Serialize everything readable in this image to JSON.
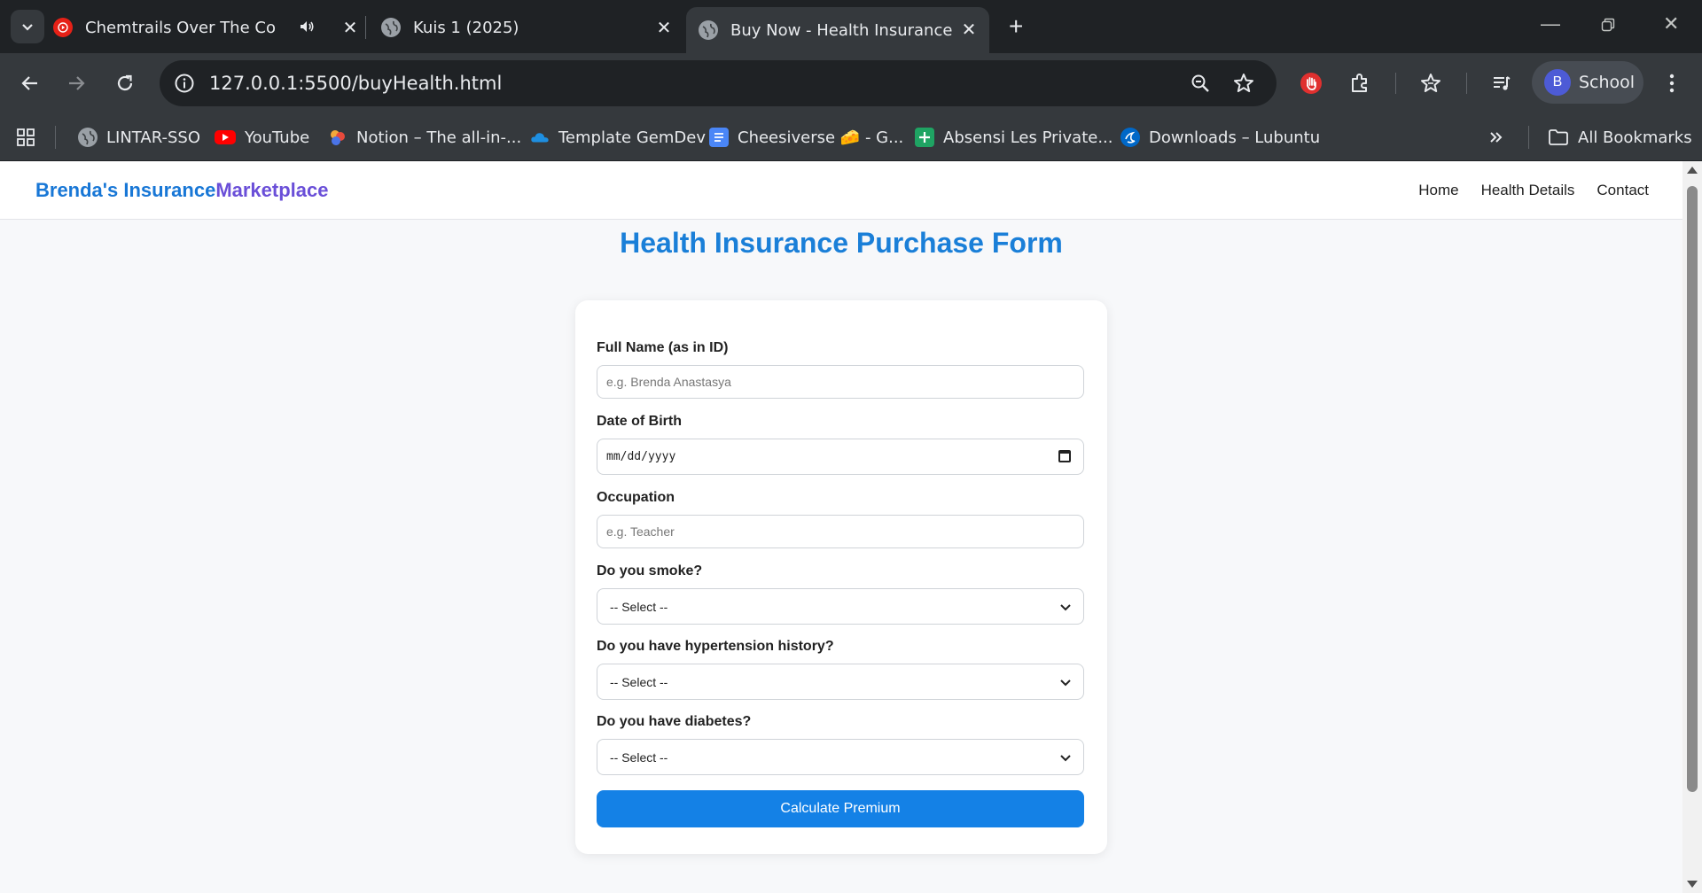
{
  "browser": {
    "tabs": [
      {
        "title": "Chemtrails Over The Countr",
        "favicon": "youtube-music-icon",
        "audio": true
      },
      {
        "title": "Kuis 1 (2025)",
        "favicon": "globe-icon"
      },
      {
        "title": "Buy Now - Health Insurance",
        "favicon": "globe-icon",
        "active": true
      }
    ],
    "url": "127.0.0.1:5500/buyHealth.html",
    "profile": {
      "initial": "B",
      "label": "School"
    },
    "bookmarks": [
      {
        "label": "LINTAR-SSO",
        "icon": "globe-icon"
      },
      {
        "label": "YouTube",
        "icon": "youtube-icon"
      },
      {
        "label": "Notion – The all-in-...",
        "icon": "notion-icon"
      },
      {
        "label": "Template GemDev",
        "icon": "onedrive-icon"
      },
      {
        "label": "Cheesiverse 🧀 - G...",
        "icon": "google-docs-icon"
      },
      {
        "label": "Absensi Les Private...",
        "icon": "google-sheets-icon"
      },
      {
        "label": "Downloads – Lubuntu",
        "icon": "lubuntu-icon"
      }
    ],
    "all_bookmarks_label": "All Bookmarks"
  },
  "site": {
    "brand_main": "Brenda's Insurance",
    "brand_accent": "Marketplace",
    "nav": [
      "Home",
      "Health Details",
      "Contact"
    ],
    "page_title": "Health Insurance Purchase Form"
  },
  "form": {
    "full_name": {
      "label": "Full Name (as in ID)",
      "placeholder": "e.g. Brenda Anastasya"
    },
    "dob": {
      "label": "Date of Birth",
      "placeholder": "mm/dd/yyyy"
    },
    "occupation": {
      "label": "Occupation",
      "placeholder": "e.g. Teacher"
    },
    "smoke": {
      "label": "Do you smoke?",
      "value": "-- Select --"
    },
    "hypertension": {
      "label": "Do you have hypertension history?",
      "value": "-- Select --"
    },
    "diabetes": {
      "label": "Do you have diabetes?",
      "value": "-- Select --"
    },
    "submit_label": "Calculate Premium"
  },
  "colors": {
    "brand_blue": "#1877d6",
    "brand_purple": "#6a4fd8",
    "button_blue": "#1481e6"
  }
}
